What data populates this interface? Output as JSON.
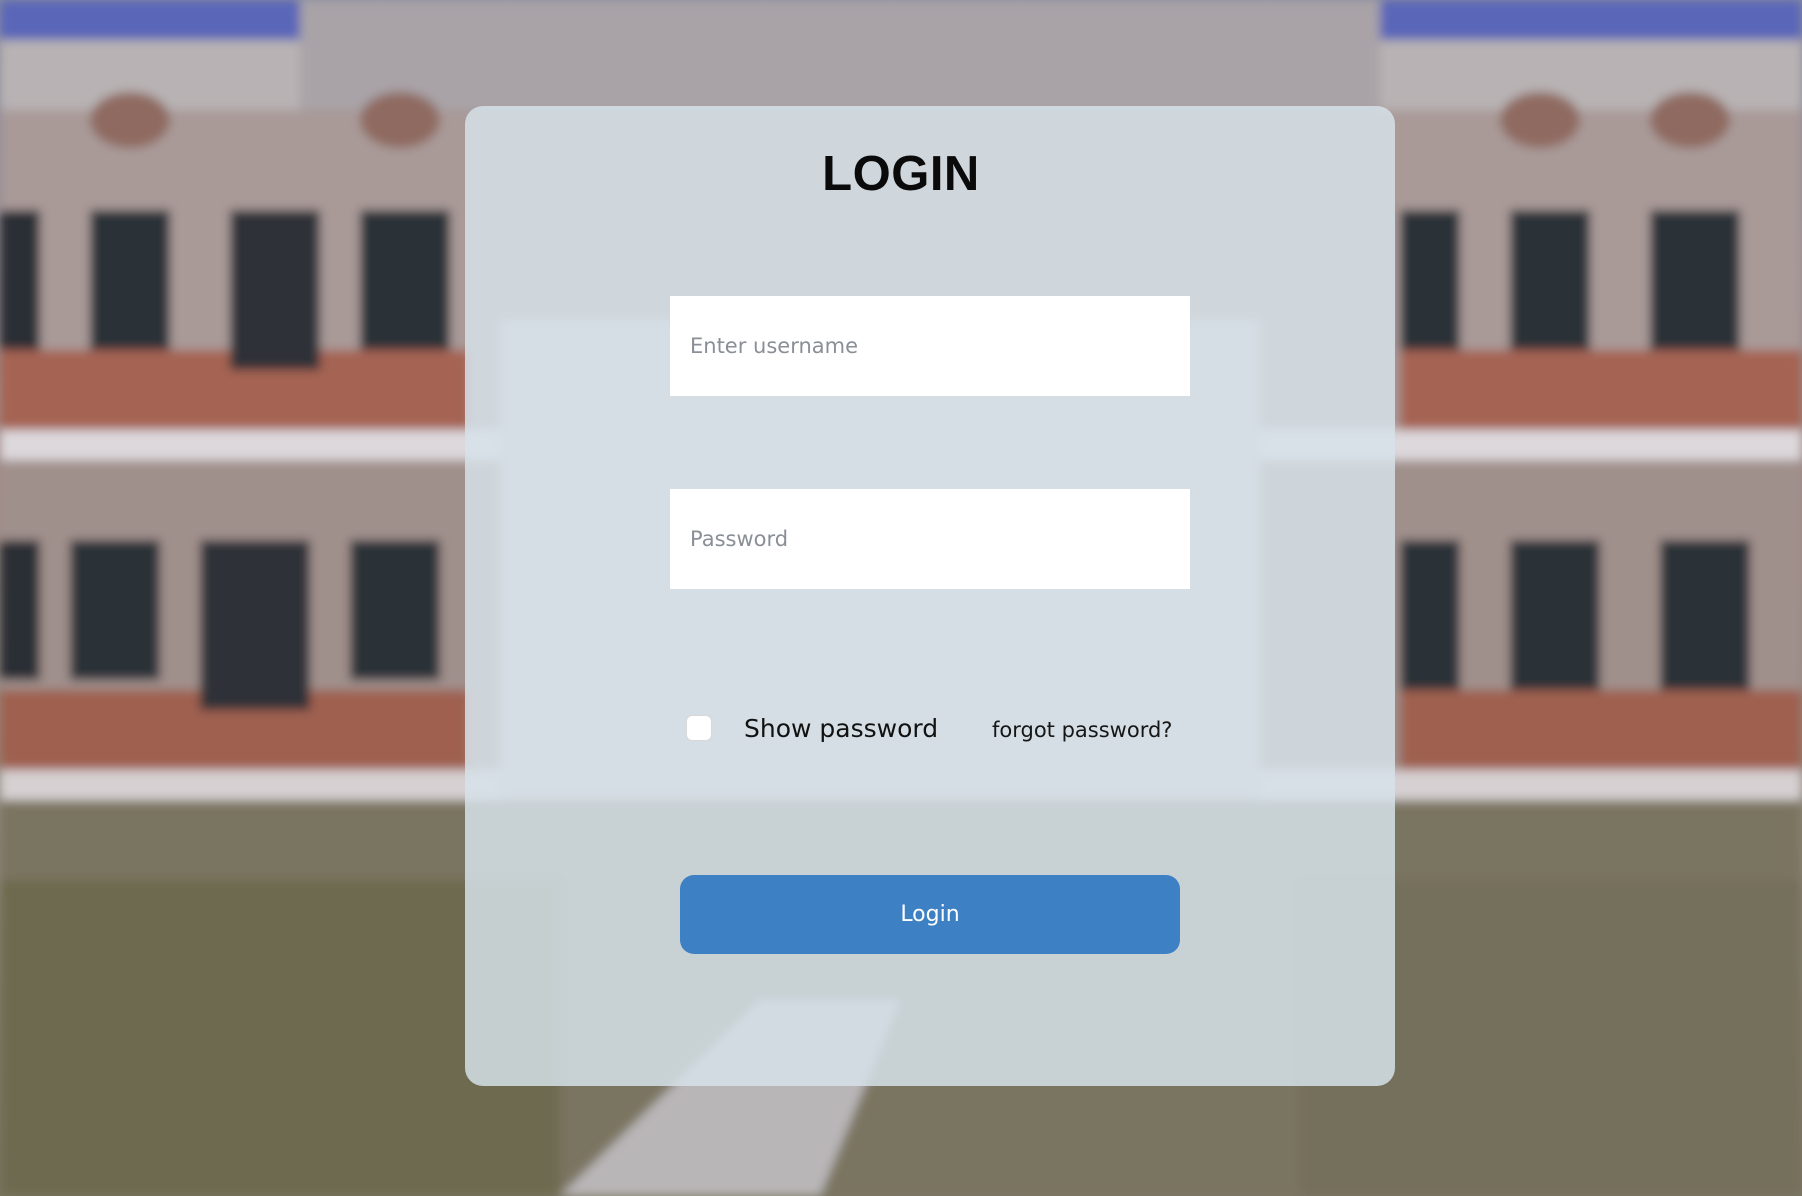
{
  "login": {
    "title": "LOGIN",
    "username_placeholder": "Enter username",
    "password_placeholder": "Password",
    "show_password_label": "Show password",
    "show_password_checked": false,
    "forgot_password_label": "forgot password?",
    "submit_label": "Login"
  },
  "colors": {
    "button_bg": "#3d80c4",
    "card_bg": "rgba(214,226,234,0.84)",
    "title_text": "#0a0a0a"
  }
}
